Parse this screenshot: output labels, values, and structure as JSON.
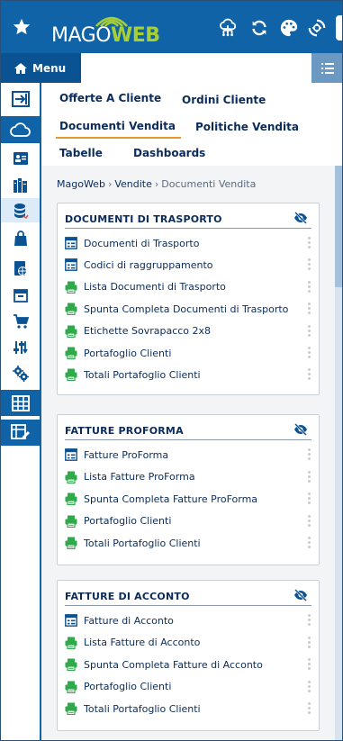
{
  "app": {
    "logo_part1": "MAGO",
    "logo_part2": "WEB",
    "menu_label": "Menu"
  },
  "colors": {
    "topbar": "#0f63a6",
    "accent": "#e8962c",
    "logo_green": "#a6cf38",
    "print_icon": "#2eaa4a"
  },
  "topbar_icons": [
    "star-icon",
    "cloud-tree-icon",
    "refresh-icon",
    "palette-icon",
    "settings-sync-icon"
  ],
  "rail_icons": [
    "exit-icon",
    "cloud-icon",
    "contacts-icon",
    "books-icon",
    "stack-icon",
    "bag-icon",
    "globe-doc-icon",
    "box-icon",
    "cart-icon",
    "sliders-icon",
    "cogs-icon",
    "grid-icon",
    "grid-edit-icon"
  ],
  "tabs": [
    {
      "label": "Offerte A Cliente"
    },
    {
      "label": "Ordini Cliente"
    },
    {
      "label": "Documenti Vendita"
    },
    {
      "label": "Politiche Vendita"
    },
    {
      "label": "Tabelle"
    },
    {
      "label": "Dashboards"
    }
  ],
  "breadcrumb": {
    "items": [
      "MagoWeb",
      "Vendite",
      "Documenti Vendita"
    ]
  },
  "cards": [
    {
      "title": "DOCUMENTI DI TRASPORTO",
      "items": [
        {
          "label": "Documenti di Trasporto",
          "icon": "form-icon"
        },
        {
          "label": "Codici di raggruppamento",
          "icon": "form-icon"
        },
        {
          "label": "Lista Documenti di Trasporto",
          "icon": "print-icon"
        },
        {
          "label": "Spunta Completa Documenti di Trasporto",
          "icon": "print-icon"
        },
        {
          "label": "Etichette Sovrapacco 2x8",
          "icon": "print-icon"
        },
        {
          "label": "Portafoglio Clienti",
          "icon": "print-icon"
        },
        {
          "label": "Totali Portafoglio Clienti",
          "icon": "print-icon"
        }
      ]
    },
    {
      "title": "FATTURE PROFORMA",
      "items": [
        {
          "label": "Fatture ProForma",
          "icon": "form-icon"
        },
        {
          "label": "Lista Fatture ProForma",
          "icon": "print-icon"
        },
        {
          "label": "Spunta Completa Fatture ProForma",
          "icon": "print-icon"
        },
        {
          "label": "Portafoglio Clienti",
          "icon": "print-icon"
        },
        {
          "label": "Totali Portafoglio Clienti",
          "icon": "print-icon"
        }
      ]
    },
    {
      "title": "FATTURE DI ACCONTO",
      "items": [
        {
          "label": "Fatture di Acconto",
          "icon": "form-icon"
        },
        {
          "label": "Lista Fatture di Acconto",
          "icon": "print-icon"
        },
        {
          "label": "Spunta Completa Fatture di Acconto",
          "icon": "print-icon"
        },
        {
          "label": "Portafoglio Clienti",
          "icon": "print-icon"
        },
        {
          "label": "Totali Portafoglio Clienti",
          "icon": "print-icon"
        }
      ]
    }
  ]
}
